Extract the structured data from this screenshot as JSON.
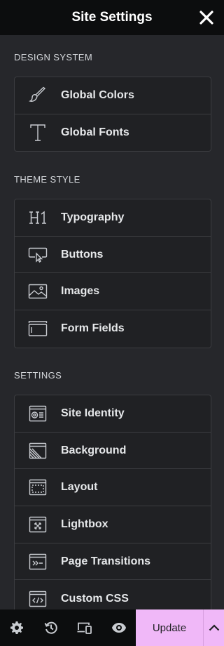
{
  "header": {
    "title": "Site Settings"
  },
  "sections": [
    {
      "title": "DESIGN SYSTEM",
      "items": [
        {
          "label": "Global Colors",
          "icon": "brush-icon"
        },
        {
          "label": "Global Fonts",
          "icon": "font-icon"
        }
      ]
    },
    {
      "title": "THEME STYLE",
      "items": [
        {
          "label": "Typography",
          "icon": "heading-icon"
        },
        {
          "label": "Buttons",
          "icon": "button-cursor-icon"
        },
        {
          "label": "Images",
          "icon": "image-icon"
        },
        {
          "label": "Form Fields",
          "icon": "form-field-icon"
        }
      ]
    },
    {
      "title": "SETTINGS",
      "items": [
        {
          "label": "Site Identity",
          "icon": "site-identity-icon"
        },
        {
          "label": "Background",
          "icon": "background-icon"
        },
        {
          "label": "Layout",
          "icon": "layout-icon"
        },
        {
          "label": "Lightbox",
          "icon": "lightbox-icon"
        },
        {
          "label": "Page Transitions",
          "icon": "page-transitions-icon"
        },
        {
          "label": "Custom CSS",
          "icon": "code-icon"
        }
      ]
    }
  ],
  "footer": {
    "buttons": [
      "gear-icon",
      "history-icon",
      "responsive-icon",
      "eye-icon"
    ],
    "update_label": "Update",
    "accent": "#f0b8f8"
  }
}
